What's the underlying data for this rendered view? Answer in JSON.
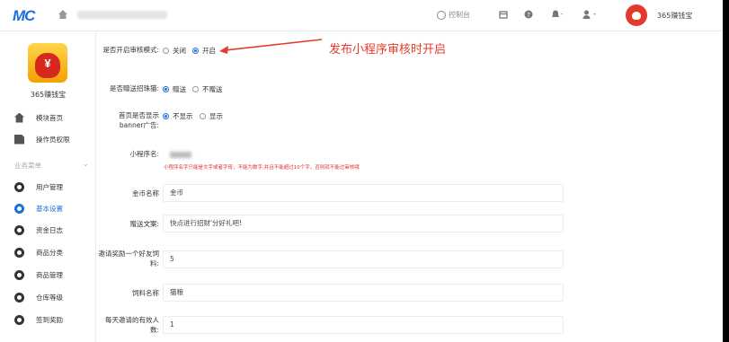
{
  "header": {
    "logo": "MC",
    "console_label": "控制台",
    "user_name": "365赚钱宝"
  },
  "sidebar": {
    "app_name": "365赚钱宝",
    "items": [
      {
        "label": "模块首页",
        "icon": "home-icon"
      },
      {
        "label": "操作员权限",
        "icon": "document-icon"
      }
    ],
    "section_title": "业务菜单",
    "menu": [
      {
        "label": "用户管理",
        "icon": "gear-icon"
      },
      {
        "label": "基本设置",
        "icon": "gear-icon",
        "active": true
      },
      {
        "label": "资金日志",
        "icon": "gear-icon"
      },
      {
        "label": "商品分类",
        "icon": "gear-icon"
      },
      {
        "label": "商品管理",
        "icon": "gear-icon"
      },
      {
        "label": "仓库等级",
        "icon": "gear-icon"
      },
      {
        "label": "签到奖励",
        "icon": "gear-icon"
      }
    ]
  },
  "form": {
    "review_mode": {
      "label": "是否开启审核模式:",
      "options": [
        "关闭",
        "开启"
      ],
      "selected": "开启"
    },
    "gift_food": {
      "label": "是否赠送招珠猫:",
      "options": [
        "赠送",
        "不赠送"
      ],
      "selected": "赠送"
    },
    "home_banner": {
      "label": "首页是否显示banner广告:",
      "options": [
        "不显示",
        "显示"
      ],
      "selected": "不显示"
    },
    "mini_program_name": {
      "label": "小程序名:",
      "hint": "小程序名字只能是文字或者字母，不能为数字,并且不能超过10个字，否则就不能过审核哦"
    },
    "coin_name": {
      "label": "金币名称",
      "value": "金币"
    },
    "gift_text": {
      "label": "赠送文案:",
      "value": "快点进行招财'分好礼吧!"
    },
    "invite_reward": {
      "label": "邀请奖励一个好友饲料:",
      "value": "5"
    },
    "feed_name": {
      "label": "饲料名称",
      "value": "猫粮"
    },
    "daily_invite": {
      "label": "每天邀请的有效人数:",
      "value": "1"
    }
  },
  "annotation": {
    "text": "发布小程序审核时开启",
    "color": "#e63a2e"
  },
  "colors": {
    "accent": "#1e6fd9",
    "warning": "#e03030"
  }
}
